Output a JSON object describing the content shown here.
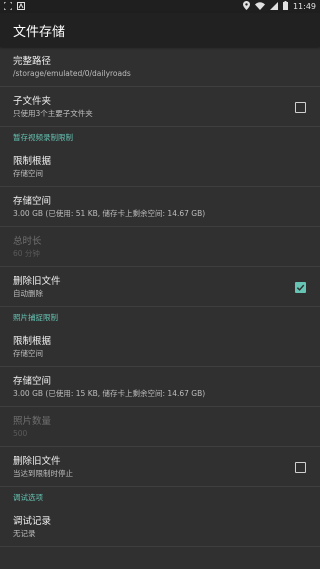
{
  "status_bar": {
    "left_icons": [
      "screenshot-icon",
      "notification-a-icon"
    ],
    "right_icons": [
      "location-icon",
      "wifi-icon",
      "signal-icon",
      "battery-icon"
    ],
    "time": "11:49"
  },
  "app_bar": {
    "title": "文件存储"
  },
  "items": {
    "full_path": {
      "title": "完整路径",
      "sub": "/storage/emulated/0/dailyroads"
    },
    "subfolder": {
      "title": "子文件夹",
      "sub": "只使用3个主要子文件夹",
      "checked": false
    },
    "video_section": "暂存视频录制限制",
    "video_limit_basis": {
      "title": "限制根据",
      "sub": "存储空间"
    },
    "video_storage": {
      "title": "存储空间",
      "sub": "3.00 GB (已使用: 51 KB, 储存卡上剩余空间: 14.67 GB)"
    },
    "total_duration": {
      "title": "总时长",
      "sub": "60 分钟"
    },
    "video_delete_old": {
      "title": "删除旧文件",
      "sub": "自动删除",
      "checked": true
    },
    "photo_section": "照片捕捉限制",
    "photo_limit_basis": {
      "title": "限制根据",
      "sub": "存储空间"
    },
    "photo_storage": {
      "title": "存储空间",
      "sub": "3.00 GB (已使用: 15 KB, 储存卡上剩余空间: 14.67 GB)"
    },
    "photo_count": {
      "title": "照片数量",
      "sub": "500"
    },
    "photo_delete_old": {
      "title": "删除旧文件",
      "sub": "当达到限制时停止",
      "checked": false
    },
    "debug_section": "调试选项",
    "debug_log": {
      "title": "调试记录",
      "sub": "无记录"
    }
  },
  "colors": {
    "accent": "#66c4b4",
    "background": "#303030",
    "app_bar": "#212121"
  }
}
